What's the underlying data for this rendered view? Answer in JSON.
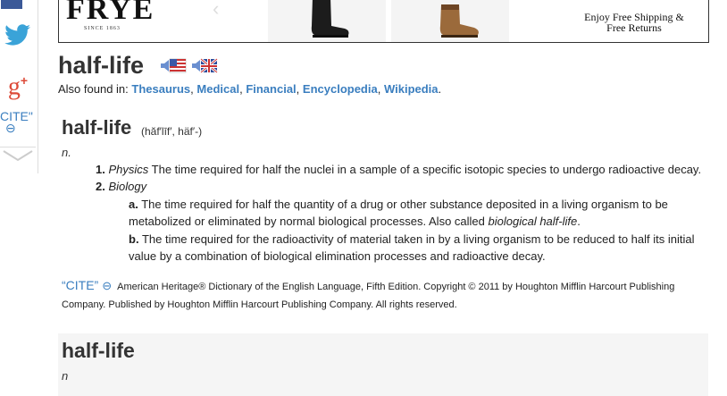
{
  "ad": {
    "brand": "FRYE",
    "since": "SINCE 1863",
    "shipping_line1": "Enjoy Free Shipping &",
    "shipping_line2": "Free Returns"
  },
  "share": {
    "cite_label": "CITE\"",
    "cite_link_glyph": "⊖"
  },
  "headword": "half-life",
  "also_found": {
    "label": "Also found in:",
    "links": [
      "Thesaurus",
      "Medical",
      "Financial",
      "Encyclopedia",
      "Wikipedia"
    ]
  },
  "entry": {
    "headword": "half-life",
    "pronunciation": "(hăf′līf′, häf′-)",
    "pos": "n.",
    "defs": [
      {
        "num": "1.",
        "field": "Physics",
        "text": "The time required for half the nuclei in a sample of a specific isotopic species to undergo radioactive decay."
      },
      {
        "num": "2.",
        "field": "Biology",
        "text": ""
      }
    ],
    "subdefs": [
      {
        "letter": "a.",
        "text": "The time required for half the quantity of a drug or other substance deposited in a living organism to be metabolized or eliminated by normal biological processes. Also called ",
        "term": "biological half-life",
        "after": "."
      },
      {
        "letter": "b.",
        "text": "The time required for the radioactivity of material taken in by a living organism to be reduced to half its initial value by a combination of biological elimination processes and radioactive decay.",
        "term": "",
        "after": ""
      }
    ],
    "citation": {
      "cite_label": "“CITE”",
      "text": "American Heritage® Dictionary of the English Language, Fifth Edition. Copyright © 2011 by Houghton Mifflin Harcourt Publishing Company. Published by Houghton Mifflin Harcourt Publishing Company. All rights reserved."
    }
  },
  "entry2": {
    "headword": "half-life",
    "pos": "n"
  },
  "colors": {
    "link": "#3a7ebf",
    "facebook": "#3b5998",
    "twitter": "#3aa3d8",
    "gplus": "#dd4b39"
  }
}
